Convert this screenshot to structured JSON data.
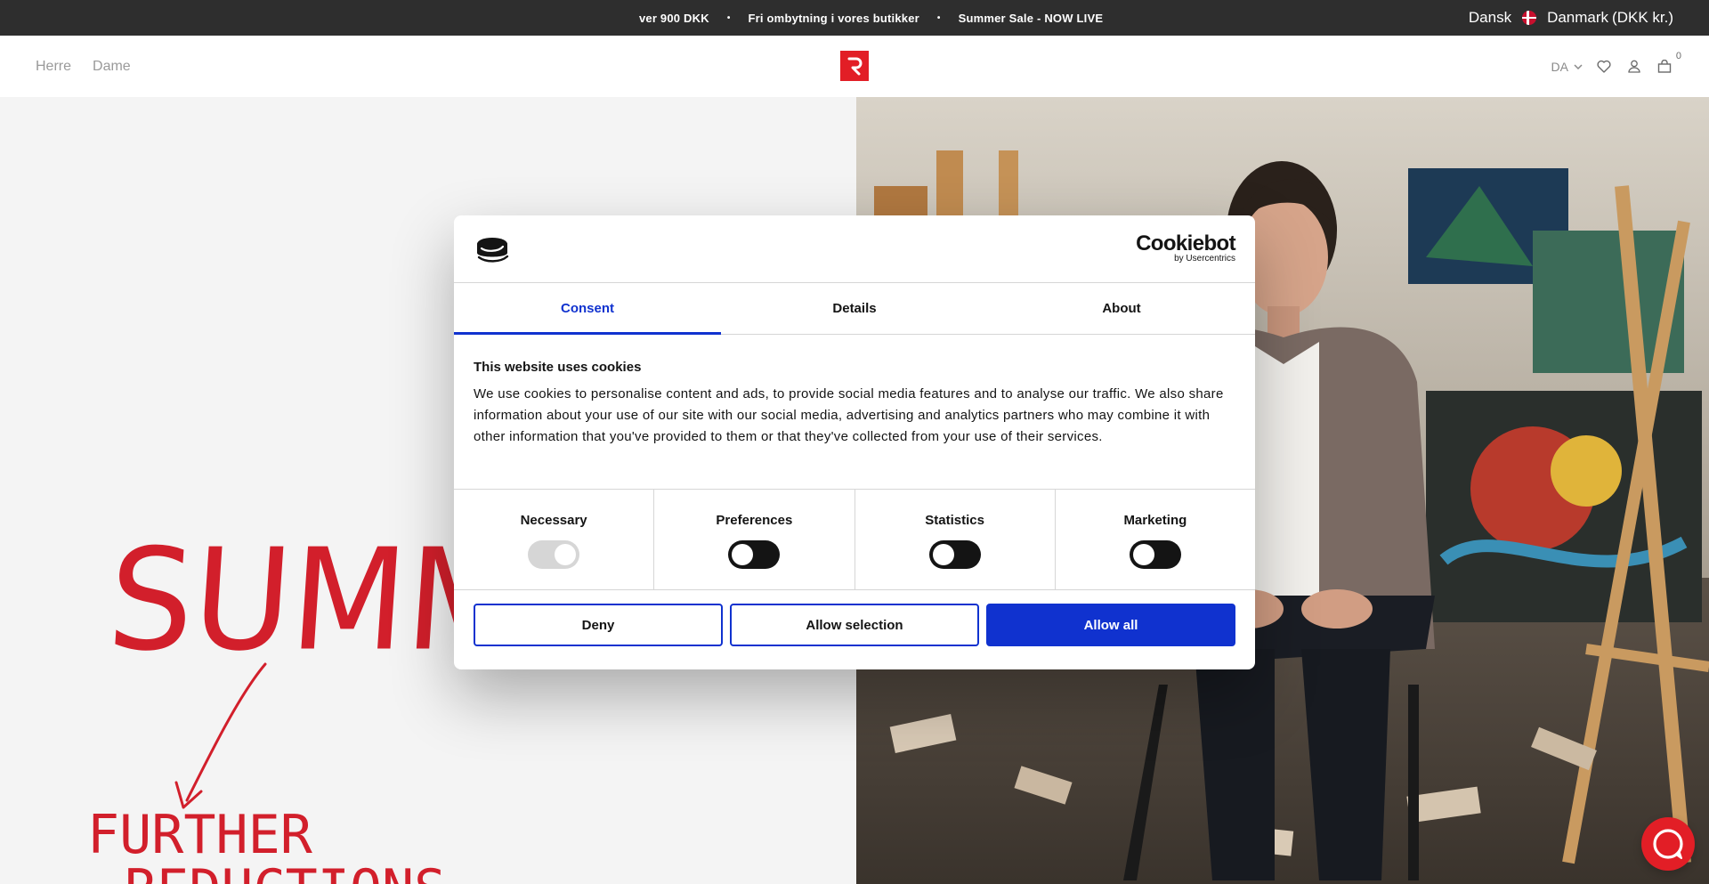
{
  "announcement": {
    "items": [
      "ver 900 DKK",
      "Fri ombytning i vores butikker",
      "Summer Sale - NOW LIVE"
    ],
    "separator": "•",
    "language": "Dansk",
    "country": "Danmark",
    "currency": "(DKK kr.)"
  },
  "header": {
    "nav": [
      "Herre",
      "Dame"
    ],
    "lang_select": "DA",
    "cart_count": "0"
  },
  "hero": {
    "headline": "SUMMER",
    "subline_1": "FURTHER",
    "subline_2": "REDUCTIONS"
  },
  "cookie_dialog": {
    "brand_name": "Cookiebot",
    "brand_by": "by Usercentrics",
    "tabs": [
      {
        "label": "Consent",
        "active": true
      },
      {
        "label": "Details",
        "active": false
      },
      {
        "label": "About",
        "active": false
      }
    ],
    "heading": "This website uses cookies",
    "body": "We use cookies to personalise content and ads, to provide social media features and to analyse our traffic. We also share information about your use of our site with our social media, advertising and analytics partners who may combine it with other information that you've provided to them or that they've collected from your use of their services.",
    "categories": [
      {
        "label": "Necessary",
        "state": "on-disabled"
      },
      {
        "label": "Preferences",
        "state": "off"
      },
      {
        "label": "Statistics",
        "state": "off"
      },
      {
        "label": "Marketing",
        "state": "off"
      }
    ],
    "buttons": {
      "deny": "Deny",
      "allow_selection": "Allow selection",
      "allow_all": "Allow all"
    }
  },
  "colors": {
    "accent_blue": "#1032cf",
    "brand_red": "#e21e26",
    "topbar_bg": "#2e2e2e"
  }
}
